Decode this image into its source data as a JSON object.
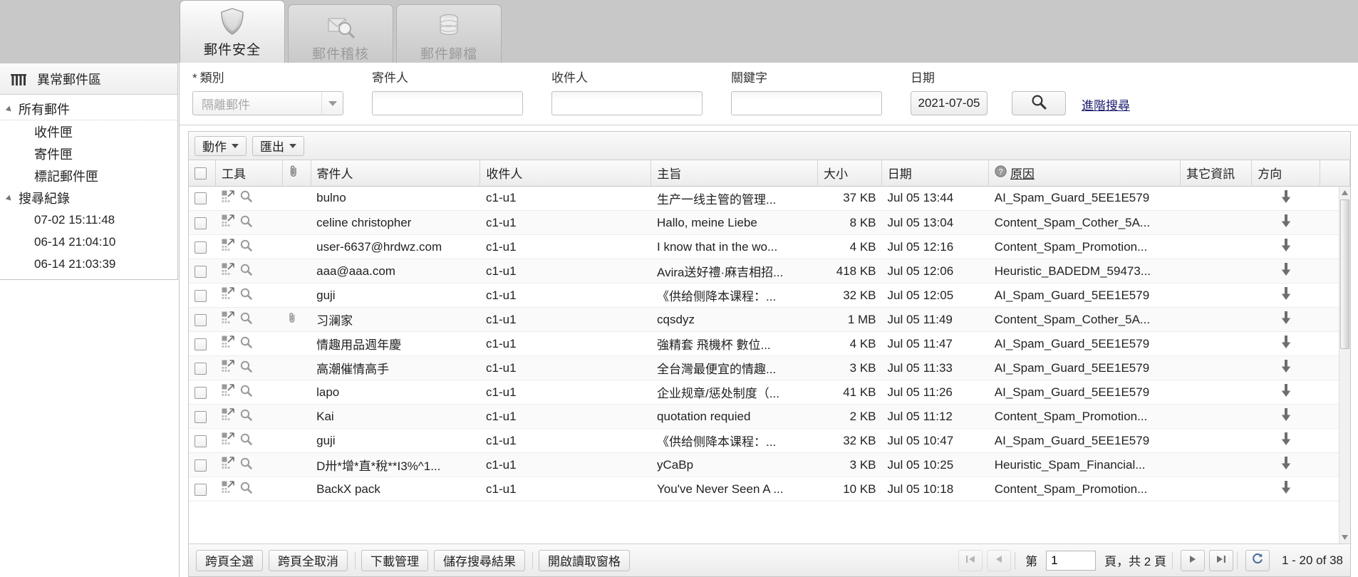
{
  "tabs": [
    {
      "label": "郵件安全",
      "icon": "shield-icon",
      "active": true
    },
    {
      "label": "郵件稽核",
      "icon": "mail-magnifier-icon",
      "active": false
    },
    {
      "label": "郵件歸檔",
      "icon": "database-icon",
      "active": false
    }
  ],
  "sidebar": {
    "header": {
      "title": "異常郵件區",
      "icon": "grid-icon"
    },
    "tree": [
      {
        "label": "所有郵件",
        "level": 0,
        "expandable": true
      },
      {
        "label": "收件匣",
        "level": 1,
        "expandable": false
      },
      {
        "label": "寄件匣",
        "level": 1,
        "expandable": false
      },
      {
        "label": "標記郵件匣",
        "level": 1,
        "expandable": false
      },
      {
        "label": "搜尋紀錄",
        "level": 0,
        "expandable": true
      },
      {
        "label": "07-02 15:11:48",
        "level": 1,
        "expandable": false
      },
      {
        "label": "06-14 21:04:10",
        "level": 1,
        "expandable": false
      },
      {
        "label": "06-14 21:03:39",
        "level": 1,
        "expandable": false
      }
    ]
  },
  "search": {
    "category": {
      "label": "類別",
      "required_mark": "*",
      "value": "隔離郵件"
    },
    "sender": {
      "label": "寄件人",
      "value": ""
    },
    "recipient": {
      "label": "收件人",
      "value": ""
    },
    "keyword": {
      "label": "關鍵字",
      "value": ""
    },
    "date": {
      "label": "日期",
      "value": "2021-07-05"
    },
    "search_button_icon": "magnifier-icon",
    "advanced_link": "進階搜尋"
  },
  "toolbar": {
    "action_label": "動作",
    "export_label": "匯出"
  },
  "grid": {
    "columns": [
      {
        "key": "checkbox",
        "label": ""
      },
      {
        "key": "tools",
        "label": "工具"
      },
      {
        "key": "attachment",
        "label": "",
        "icon": "paperclip-icon"
      },
      {
        "key": "sender",
        "label": "寄件人"
      },
      {
        "key": "recipient",
        "label": "收件人"
      },
      {
        "key": "subject",
        "label": "主旨"
      },
      {
        "key": "size",
        "label": "大小"
      },
      {
        "key": "date",
        "label": "日期"
      },
      {
        "key": "reason",
        "label": "原因",
        "icon": "help-icon"
      },
      {
        "key": "other",
        "label": "其它資訊"
      },
      {
        "key": "direction",
        "label": "方向"
      }
    ],
    "rows": [
      {
        "sender": "bulno",
        "recipient": "c1-u1",
        "subject": "生产一线主管的管理...",
        "size": "37 KB",
        "date": "Jul 05 13:44",
        "reason": "AI_Spam_Guard_5EE1E579",
        "other": "",
        "direction": "down",
        "attachment": false
      },
      {
        "sender": "celine christopher",
        "recipient": "c1-u1",
        "subject": "Hallo, meine Liebe",
        "size": "8 KB",
        "date": "Jul 05 13:04",
        "reason": "Content_Spam_Cother_5A...",
        "other": "",
        "direction": "down",
        "attachment": false
      },
      {
        "sender": "user-6637@hrdwz.com",
        "recipient": "c1-u1",
        "subject": "I know that in the wo...",
        "size": "4 KB",
        "date": "Jul 05 12:16",
        "reason": "Content_Spam_Promotion...",
        "other": "",
        "direction": "down",
        "attachment": false
      },
      {
        "sender": "aaa@aaa.com",
        "recipient": "c1-u1",
        "subject": "Avira送好禮·麻吉相招...",
        "size": "418 KB",
        "date": "Jul 05 12:06",
        "reason": "Heuristic_BADEDM_59473...",
        "other": "",
        "direction": "down",
        "attachment": false
      },
      {
        "sender": "guji",
        "recipient": "c1-u1",
        "subject": "《供给侧降本课程：...",
        "size": "32 KB",
        "date": "Jul 05 12:05",
        "reason": "AI_Spam_Guard_5EE1E579",
        "other": "",
        "direction": "down",
        "attachment": false
      },
      {
        "sender": "习澜家",
        "recipient": "c1-u1",
        "subject": "cqsdyz",
        "size": "1 MB",
        "date": "Jul 05 11:49",
        "reason": "Content_Spam_Cother_5A...",
        "other": "",
        "direction": "down",
        "attachment": true
      },
      {
        "sender": "情趣用品週年慶",
        "recipient": "c1-u1",
        "subject": "強精套 飛機杯 數位...",
        "size": "4 KB",
        "date": "Jul 05 11:47",
        "reason": "AI_Spam_Guard_5EE1E579",
        "other": "",
        "direction": "down",
        "attachment": false
      },
      {
        "sender": "高潮催情高手",
        "recipient": "c1-u1",
        "subject": "全台灣最便宜的情趣...",
        "size": "3 KB",
        "date": "Jul 05 11:33",
        "reason": "AI_Spam_Guard_5EE1E579",
        "other": "",
        "direction": "down",
        "attachment": false
      },
      {
        "sender": "lapo",
        "recipient": "c1-u1",
        "subject": "企业规章/惩处制度（...",
        "size": "41 KB",
        "date": "Jul 05 11:26",
        "reason": "AI_Spam_Guard_5EE1E579",
        "other": "",
        "direction": "down",
        "attachment": false
      },
      {
        "sender": "Kai",
        "recipient": "c1-u1",
        "subject": "quotation requied",
        "size": "2 KB",
        "date": "Jul 05 11:12",
        "reason": "Content_Spam_Promotion...",
        "other": "",
        "direction": "down",
        "attachment": false
      },
      {
        "sender": "guji",
        "recipient": "c1-u1",
        "subject": "《供给侧降本课程：...",
        "size": "32 KB",
        "date": "Jul 05 10:47",
        "reason": "AI_Spam_Guard_5EE1E579",
        "other": "",
        "direction": "down",
        "attachment": false
      },
      {
        "sender": "D卅*增*直*稅**I3%^1...",
        "recipient": "c1-u1",
        "subject": "yCaBp",
        "size": "3 KB",
        "date": "Jul 05 10:25",
        "reason": "Heuristic_Spam_Financial...",
        "other": "",
        "direction": "down",
        "attachment": false
      },
      {
        "sender": "BackX pack",
        "recipient": "c1-u1",
        "subject": "You've Never Seen A ...",
        "size": "10 KB",
        "date": "Jul 05 10:18",
        "reason": "Content_Spam_Promotion...",
        "other": "",
        "direction": "down",
        "attachment": false
      }
    ]
  },
  "footer": {
    "buttons": [
      {
        "label": "跨頁全選",
        "sep_after": false
      },
      {
        "label": "跨頁全取消",
        "sep_after": true
      },
      {
        "label": "下載管理",
        "sep_after": false
      },
      {
        "label": "儲存搜尋結果",
        "sep_after": true
      },
      {
        "label": "開啟讀取窗格",
        "sep_after": false
      }
    ],
    "pager": {
      "first_icon": "first-page-icon",
      "prev_icon": "prev-page-icon",
      "page_prefix": "第",
      "page_value": "1",
      "page_suffix": "頁，共 2 頁",
      "next_icon": "next-page-icon",
      "last_icon": "last-page-icon",
      "refresh_icon": "refresh-icon",
      "totals": "1 - 20 of 38"
    }
  }
}
